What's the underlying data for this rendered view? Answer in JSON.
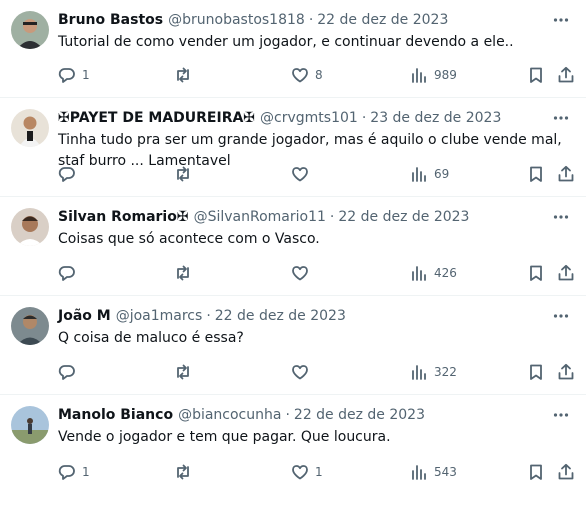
{
  "tweets": [
    {
      "name": "Bruno Bastos",
      "handle": "@brunobastos1818",
      "separator": "·",
      "date": "22 de dez de 2023",
      "text": "Tutorial de como vender um jogador, e continuar devendo a ele..",
      "replies": "1",
      "retweets": "",
      "likes": "8",
      "views": "989"
    },
    {
      "name": "✠PAYET DE MADUREIRA✠",
      "handle": "@crvgmts101",
      "separator": "·",
      "date": "23 de dez de 2023",
      "text": "Tinha tudo pra ser um grande jogador, mas é aquilo o clube vende mal, staf burro ... Lamentavel",
      "replies": "",
      "retweets": "",
      "likes": "",
      "views": "69"
    },
    {
      "name": "Silvan Romario✠",
      "handle": "@SilvanRomario11",
      "separator": "·",
      "date": "22 de dez de 2023",
      "text": "Coisas que só acontece com o Vasco.",
      "replies": "",
      "retweets": "",
      "likes": "",
      "views": "426"
    },
    {
      "name": "João M",
      "handle": "@joa1marcs",
      "separator": "·",
      "date": "22 de dez de 2023",
      "text": "Q coisa de maluco é essa?",
      "replies": "",
      "retweets": "",
      "likes": "",
      "views": "322"
    },
    {
      "name": "Manolo Bianco",
      "handle": "@biancocunha",
      "separator": "·",
      "date": "22 de dez de 2023",
      "text": "Vende o jogador e tem que pagar. Que loucura.",
      "replies": "1",
      "retweets": "",
      "likes": "1",
      "views": "543"
    }
  ],
  "icons": {
    "more": "more-dots-icon",
    "reply": "reply-icon",
    "retweet": "retweet-icon",
    "like": "heart-icon",
    "views": "views-chart-icon",
    "bookmark": "bookmark-icon",
    "share": "share-icon"
  },
  "colors": {
    "text": "#0f1419",
    "secondary": "#536471",
    "divider": "#eff3f4"
  }
}
